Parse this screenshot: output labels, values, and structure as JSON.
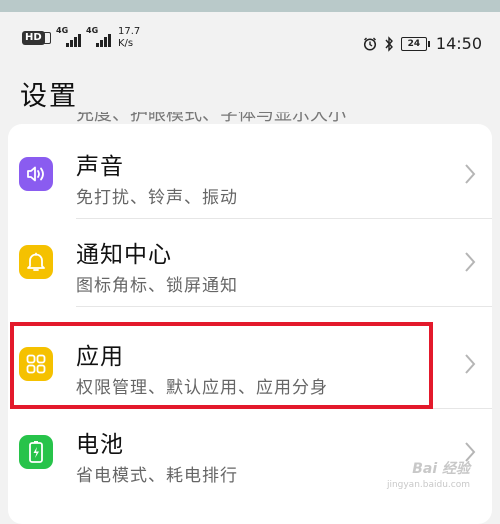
{
  "status_bar": {
    "hd": "HD",
    "sim1": "4G",
    "sim2": "4G",
    "speed_value": "17.7",
    "speed_unit": "K/s",
    "battery": "24",
    "time": "14:50"
  },
  "header": {
    "title": "设置"
  },
  "clipped_row_text": "充度、护眼模式、字体与显示大小",
  "rows": [
    {
      "label": "声音",
      "subtitle": "免打扰、铃声、振动",
      "icon": "speaker-icon",
      "icon_color": "#8a5cf0"
    },
    {
      "label": "通知中心",
      "subtitle": "图标角标、锁屏通知",
      "icon": "bell-icon",
      "icon_color": "#f5c100"
    },
    {
      "label": "应用",
      "subtitle": "权限管理、默认应用、应用分身",
      "icon": "apps-grid-icon",
      "icon_color": "#f5c100"
    },
    {
      "label": "电池",
      "subtitle": "省电模式、耗电排行",
      "icon": "battery-icon",
      "icon_color": "#27c34a"
    }
  ],
  "highlight_color": "#e3192b",
  "watermark": {
    "text": "Bai 经验",
    "subtext": "jingyan.baidu.com"
  }
}
